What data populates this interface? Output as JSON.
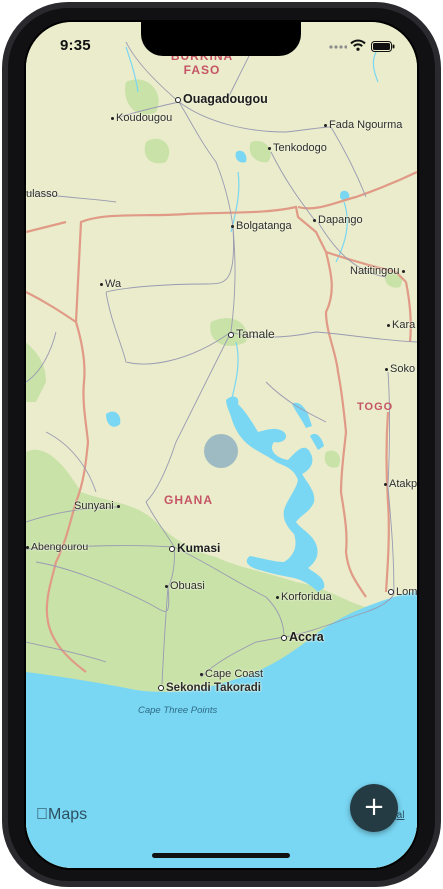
{
  "status_bar": {
    "time": "9:35"
  },
  "map": {
    "countries": [
      {
        "id": "burkina-faso",
        "name": "BURKINA FASO"
      },
      {
        "id": "ghana",
        "name": "GHANA"
      },
      {
        "id": "togo",
        "name": "TOGO"
      }
    ],
    "places": {
      "ouagadougou": "Ouagadougou",
      "koudougou": "Koudougou",
      "fada_ngourma": "Fada Ngourma",
      "tenkodogo": "Tenkodogo",
      "ulasso": "ulasso",
      "dapango": "Dapango",
      "bolgatanga": "Bolgatanga",
      "natitingou": "Natitingou",
      "wa": "Wa",
      "kara": "Kara",
      "tamale": "Tamale",
      "soko": "Soko",
      "atakp": "Atakp",
      "sunyani": "Sunyani",
      "abengourou": "Abengourou",
      "kumasi": "Kumasi",
      "obuasi": "Obuasi",
      "koforidua": "Korforidua",
      "lome": "Lom",
      "accra": "Accra",
      "cape_coast": "Cape Coast",
      "sekondi_takoradi": "Sekondi Takoradi"
    },
    "water_labels": {
      "cape_three_points": "Cape Three Points"
    },
    "colors": {
      "land": "#eaeccb",
      "forest": "#c8e2a8",
      "water": "#79d7f3",
      "border": "#e09a86",
      "road": "#9a9ab2"
    }
  },
  "overlay": {
    "maps_logo": "Maps",
    "legal": "Legal",
    "add_button_icon": "plus-icon",
    "add_button_glyph": "+"
  }
}
